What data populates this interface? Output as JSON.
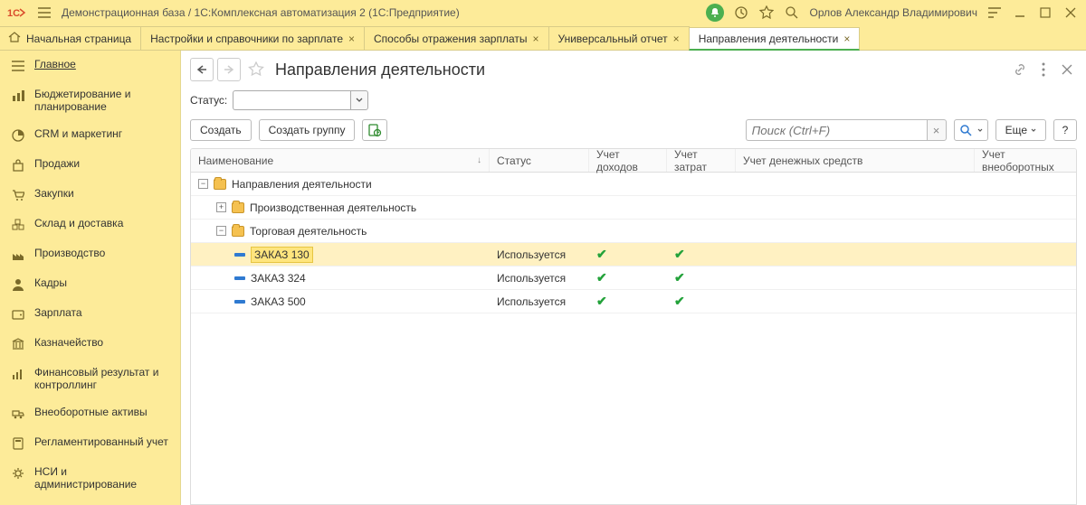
{
  "titlebar": {
    "title": "Демонстрационная база / 1С:Комплексная автоматизация 2  (1С:Предприятие)",
    "username": "Орлов Александр Владимирович"
  },
  "tabs": [
    {
      "label": "Начальная страница",
      "home": true,
      "closable": false
    },
    {
      "label": "Настройки и справочники по зарплате",
      "home": false,
      "closable": true
    },
    {
      "label": "Способы отражения зарплаты",
      "home": false,
      "closable": true
    },
    {
      "label": "Универсальный отчет",
      "home": false,
      "closable": true
    },
    {
      "label": "Направления деятельности",
      "home": false,
      "closable": true,
      "active": true
    }
  ],
  "sidebar": {
    "items": [
      {
        "label": "Главное",
        "icon": "menu",
        "active": true
      },
      {
        "label": "Бюджетирование и планирование",
        "icon": "chart"
      },
      {
        "label": "CRM и маркетинг",
        "icon": "pie"
      },
      {
        "label": "Продажи",
        "icon": "bag"
      },
      {
        "label": "Закупки",
        "icon": "cart"
      },
      {
        "label": "Склад и доставка",
        "icon": "boxes"
      },
      {
        "label": "Производство",
        "icon": "factory"
      },
      {
        "label": "Кадры",
        "icon": "person"
      },
      {
        "label": "Зарплата",
        "icon": "wallet"
      },
      {
        "label": "Казначейство",
        "icon": "bank"
      },
      {
        "label": "Финансовый результат и контроллинг",
        "icon": "bars"
      },
      {
        "label": "Внеоборотные активы",
        "icon": "truck"
      },
      {
        "label": "Регламентированный учет",
        "icon": "calc"
      },
      {
        "label": "НСИ и администрирование",
        "icon": "gear"
      }
    ]
  },
  "page": {
    "title": "Направления деятельности",
    "status_label": "Статус:"
  },
  "toolbar": {
    "create": "Создать",
    "create_group": "Создать группу",
    "search_placeholder": "Поиск (Ctrl+F)",
    "more": "Еще"
  },
  "table": {
    "columns": {
      "name": "Наименование",
      "status": "Статус",
      "income": "Учет доходов",
      "expense": "Учет затрат",
      "cash": "Учет денежных средств",
      "fixed": "Учет внеоборотных"
    },
    "rows": [
      {
        "type": "group",
        "level": 0,
        "expanded": true,
        "name": "Направления деятельности"
      },
      {
        "type": "group",
        "level": 1,
        "expanded": false,
        "name": "Производственная деятельность"
      },
      {
        "type": "group",
        "level": 1,
        "expanded": true,
        "name": "Торговая деятельность"
      },
      {
        "type": "item",
        "level": 2,
        "name": "ЗАКАЗ 130",
        "status": "Используется",
        "income": true,
        "expense": true,
        "selected": true
      },
      {
        "type": "item",
        "level": 2,
        "name": "ЗАКАЗ 324",
        "status": "Используется",
        "income": true,
        "expense": true
      },
      {
        "type": "item",
        "level": 2,
        "name": "ЗАКАЗ 500",
        "status": "Используется",
        "income": true,
        "expense": true
      }
    ]
  }
}
